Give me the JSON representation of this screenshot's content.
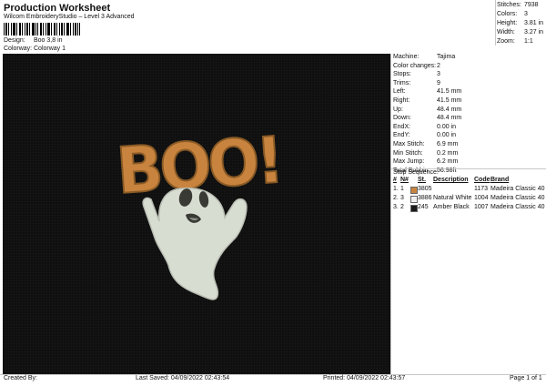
{
  "header": {
    "title": "Production Worksheet",
    "subtitle": "Wilcom EmbroideryStudio – Level 3 Advanced"
  },
  "design": {
    "design_label": "Design:",
    "design_value": "Boo 3,8 in",
    "colorway_label": "Colorway:",
    "colorway_value": "Colorway 1"
  },
  "stats": [
    {
      "label": "Stitches:",
      "value": "7938"
    },
    {
      "label": "Colors:",
      "value": "3"
    },
    {
      "label": "Height:",
      "value": "3.81 in"
    },
    {
      "label": "Width:",
      "value": "3.27 in"
    },
    {
      "label": "Zoom:",
      "value": "1:1"
    }
  ],
  "machine_info": [
    {
      "label": "Machine:",
      "value": "Tajima"
    },
    {
      "label": "Color changes:",
      "value": "2"
    },
    {
      "label": "Stops:",
      "value": "3"
    },
    {
      "label": "Trims:",
      "value": "9"
    },
    {
      "label": "Left:",
      "value": "41.5 mm"
    },
    {
      "label": "Right:",
      "value": "41.5 mm"
    },
    {
      "label": "Up:",
      "value": "48.4 mm"
    },
    {
      "label": "Down:",
      "value": "48.4 mm"
    },
    {
      "label": "EndX:",
      "value": "0.00 in"
    },
    {
      "label": "EndY:",
      "value": "0.00 in"
    },
    {
      "label": "Max Stitch:",
      "value": "6.9 mm"
    },
    {
      "label": "Min Stitch:",
      "value": "0.2 mm"
    },
    {
      "label": "Max Jump:",
      "value": "6.2 mm"
    },
    {
      "label": "Total Bobbin:",
      "value": "56.98ft"
    }
  ],
  "stop_sequence": {
    "title": "Stop Sequence:",
    "headers": {
      "num": "#",
      "n": "N#",
      "st": "St.",
      "description": "Description",
      "code": "Code",
      "brand": "Brand"
    },
    "rows": [
      {
        "num": "1.",
        "n": "1",
        "color": "#C8843F",
        "st": "3805",
        "description": "",
        "code": "1173",
        "brand": "Madeira Classic 40"
      },
      {
        "num": "2.",
        "n": "3",
        "color": "#F0F0F0",
        "st": "3886",
        "description": "Natural White",
        "code": "1004",
        "brand": "Madeira Classic 40"
      },
      {
        "num": "3.",
        "n": "2",
        "color": "#1A1A1A",
        "st": "245",
        "description": "Amber Black",
        "code": "1007",
        "brand": "Madeira Classic 40"
      }
    ]
  },
  "design_text": "BOO!",
  "footer": {
    "created_by": "Created By:",
    "last_saved": "Last Saved: 04/09/2022 02:43:54",
    "printed": "Printed: 04/09/2022 02:43:57",
    "page": "Page 1 of 1"
  },
  "colors": {
    "canvas": "#101010",
    "orange": "#C8843F",
    "ghost": "#D8DDD2"
  }
}
